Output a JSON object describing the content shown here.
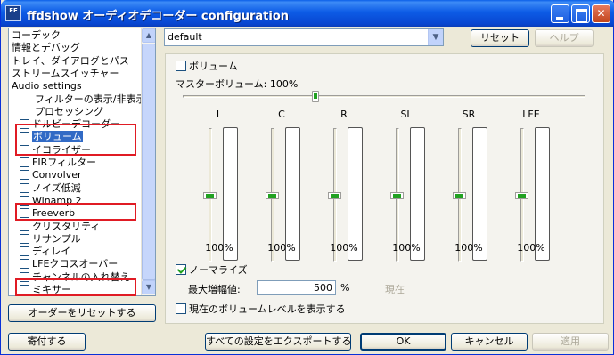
{
  "window": {
    "title": "ffdshow オーディオデコーダー configuration",
    "icon_text": "FF"
  },
  "tree": {
    "items": [
      {
        "label": "コーデック",
        "indent": 0,
        "checkbox": false
      },
      {
        "label": "情報とデバッグ",
        "indent": 0,
        "checkbox": false
      },
      {
        "label": "トレイ、ダイアログとパス",
        "indent": 0,
        "checkbox": false
      },
      {
        "label": "ストリームスイッチャー",
        "indent": 0,
        "checkbox": false
      },
      {
        "label": "Audio settings",
        "indent": 0,
        "checkbox": false
      },
      {
        "label": "フィルターの表示/非表示",
        "indent": 1,
        "checkbox": false
      },
      {
        "label": "プロセッシング",
        "indent": 1,
        "checkbox": false
      },
      {
        "label": "ドルビーデコーダー",
        "indent": 1,
        "checkbox": true,
        "checked": false
      },
      {
        "label": "ボリューム",
        "indent": 1,
        "checkbox": true,
        "checked": false,
        "selected": true
      },
      {
        "label": "イコライザー",
        "indent": 1,
        "checkbox": true,
        "checked": false
      },
      {
        "label": "FIRフィルター",
        "indent": 1,
        "checkbox": true,
        "checked": false
      },
      {
        "label": "Convolver",
        "indent": 1,
        "checkbox": true,
        "checked": false
      },
      {
        "label": "ノイズ低減",
        "indent": 1,
        "checkbox": true,
        "checked": false
      },
      {
        "label": "Winamp 2",
        "indent": 1,
        "checkbox": true,
        "checked": false
      },
      {
        "label": "Freeverb",
        "indent": 1,
        "checkbox": true,
        "checked": false
      },
      {
        "label": "クリスタリティ",
        "indent": 1,
        "checkbox": true,
        "checked": false
      },
      {
        "label": "リサンプル",
        "indent": 1,
        "checkbox": true,
        "checked": false
      },
      {
        "label": "ディレイ",
        "indent": 1,
        "checkbox": true,
        "checked": false
      },
      {
        "label": "LFEクロスオーバー",
        "indent": 1,
        "checkbox": true,
        "checked": false
      },
      {
        "label": "チャンネルの入れ替え",
        "indent": 1,
        "checkbox": true,
        "checked": false
      },
      {
        "label": "ミキサー",
        "indent": 1,
        "checkbox": true,
        "checked": false
      }
    ]
  },
  "buttons": {
    "reset_order": "オーダーをリセットする",
    "donate": "寄付する",
    "export_all": "すべての設定をエクスポートする",
    "ok": "OK",
    "cancel": "キャンセル",
    "apply": "適用",
    "reset": "リセット",
    "help": "ヘルプ"
  },
  "preset": {
    "selected": "default"
  },
  "volume": {
    "enable_label": "ボリューム",
    "enabled": false,
    "master_label": "マスターボリューム: 100%",
    "master_value_fraction": 0.33,
    "channels": [
      {
        "name": "L",
        "percent": "100%"
      },
      {
        "name": "C",
        "percent": "100%"
      },
      {
        "name": "R",
        "percent": "100%"
      },
      {
        "name": "SL",
        "percent": "100%"
      },
      {
        "name": "SR",
        "percent": "100%"
      },
      {
        "name": "LFE",
        "percent": "100%"
      }
    ],
    "normalize_label": "ノーマライズ",
    "normalize_checked": true,
    "max_amp_label": "最大増幅値:",
    "max_amp_value": "500",
    "max_amp_unit": "%",
    "current_label": "現在",
    "show_level_label": "現在のボリュームレベルを表示する",
    "show_level_checked": false
  },
  "colors": {
    "titlebar": "#0a5fe8",
    "selection": "#316ac5",
    "highlight_box": "#e01b24",
    "slider_grip": "#21a121"
  }
}
